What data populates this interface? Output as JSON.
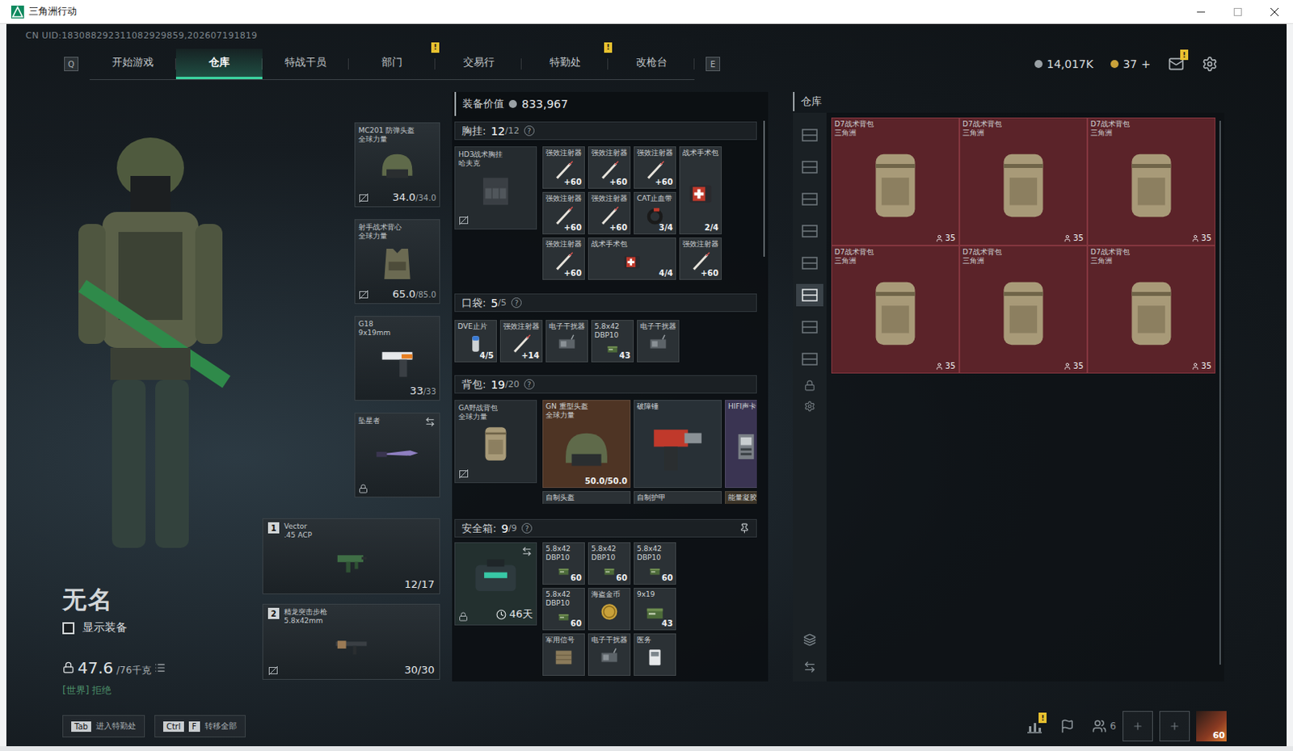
{
  "window": {
    "title": "三角洲行动"
  },
  "uid": "CN UID:183088292311082929859,202607191819",
  "nav": {
    "left_key": "Q",
    "right_key": "E",
    "tabs": [
      {
        "label": "开始游戏",
        "selected": false,
        "badge": ""
      },
      {
        "label": "仓库",
        "selected": true,
        "badge": ""
      },
      {
        "label": "特战干员",
        "selected": false,
        "badge": ""
      },
      {
        "label": "部门",
        "selected": false,
        "badge": "!"
      },
      {
        "label": "交易行",
        "selected": false,
        "badge": ""
      },
      {
        "label": "特勤处",
        "selected": false,
        "badge": "!"
      },
      {
        "label": "改枪台",
        "selected": false,
        "badge": ""
      }
    ]
  },
  "wallet": {
    "coins": "14,017K",
    "tokens": "37",
    "add": "+",
    "mail_badge": "!"
  },
  "character": {
    "name": "无名",
    "show_equipment": {
      "label": "显示装备",
      "checked": false
    },
    "weight": "47.6",
    "weight_max": "/76千克",
    "channel": "[世界] 拒绝"
  },
  "gear": [
    {
      "name": "MC201 防弹头盔",
      "sub": "全球力量",
      "reading": "34.0",
      "max": "/34.0",
      "kind": "helmet",
      "no_insure": true,
      "locked": false,
      "swap": false
    },
    {
      "name": "射手战术背心",
      "sub": "全球力量",
      "reading": "65.0",
      "max": "/85.0",
      "kind": "armor",
      "no_insure": true,
      "locked": false,
      "swap": false
    },
    {
      "name": "G18",
      "sub": "9x19mm",
      "reading": "33",
      "max": "/33",
      "kind": "pistol",
      "no_insure": false,
      "locked": false,
      "swap": false
    },
    {
      "name": "坠星者",
      "sub": "",
      "reading": "",
      "max": "",
      "kind": "knife",
      "no_insure": false,
      "locked": true,
      "swap": true
    }
  ],
  "weapons": [
    {
      "slot": "1",
      "name": "Vector",
      "sub": ".45 ACP",
      "reading": "12",
      "max": "/17",
      "kind": "smg",
      "no_insure": false
    },
    {
      "slot": "2",
      "name": "精龙突击步枪",
      "sub": "5.8x42mm",
      "reading": "30",
      "max": "/30",
      "kind": "rifle",
      "no_insure": true
    }
  ],
  "loadout": {
    "value_label": "装备价值",
    "value": "833,967",
    "rig": {
      "title": "胸挂:",
      "count": "12",
      "cap": "/12",
      "help": "?",
      "card": {
        "name": "HD3战术胸挂",
        "sub": "哈夫克",
        "no_insure": true
      },
      "items": [
        {
          "name": "强效注射器",
          "sub": "",
          "count": "+60",
          "kind": "syringe",
          "size": "small",
          "color": "#2b3135"
        },
        {
          "name": "强效注射器",
          "sub": "",
          "count": "+60",
          "kind": "syringe",
          "size": "small",
          "color": "#2b3135"
        },
        {
          "name": "强效注射器",
          "sub": "",
          "count": "+60",
          "kind": "syringe",
          "size": "small",
          "color": "#2b3135"
        },
        {
          "name": "战术手术包",
          "sub": "",
          "count": "2/4",
          "kind": "medkit",
          "size": "tall",
          "color": "#2b3135"
        },
        {
          "name": "强效注射器",
          "sub": "",
          "count": "+60",
          "kind": "syringe",
          "size": "small",
          "color": "#2b3135"
        },
        {
          "name": "强效注射器",
          "sub": "",
          "count": "+60",
          "kind": "syringe",
          "size": "small",
          "color": "#2b3135"
        },
        {
          "name": "CAT止血带",
          "sub": "",
          "count": "3/4",
          "kind": "tourniquet",
          "size": "small",
          "color": "#2b3135"
        },
        {
          "name": "强效注射器",
          "sub": "",
          "count": "+60",
          "kind": "syringe",
          "size": "small",
          "color": "#2b3135"
        },
        {
          "name": "战术手术包",
          "sub": "",
          "count": "4/4",
          "kind": "medkit",
          "size": "wide",
          "color": "#2b3135"
        },
        {
          "name": "强效注射器",
          "sub": "",
          "count": "+60",
          "kind": "syringe",
          "size": "small",
          "color": "#2b3135"
        }
      ]
    },
    "pockets": {
      "title": "口袋:",
      "count": "5",
      "cap": "/5",
      "help": "?",
      "items": [
        {
          "name": "DVE止片",
          "sub": "",
          "count": "4/5",
          "kind": "pill",
          "size": "small",
          "color": "#2b3135"
        },
        {
          "name": "强效注射器",
          "sub": "",
          "count": "+14",
          "kind": "syringe",
          "size": "small",
          "color": "#2b3135"
        },
        {
          "name": "电子干扰器",
          "sub": "",
          "count": "",
          "kind": "jammer",
          "size": "small",
          "color": "#2b3135"
        },
        {
          "name": "5.8x42 DBP10",
          "sub": "",
          "count": "43",
          "kind": "ammo",
          "size": "small",
          "color": "#2b3135"
        },
        {
          "name": "电子干扰器",
          "sub": "",
          "count": "",
          "kind": "jammer",
          "size": "small",
          "color": "#2b3135"
        }
      ]
    },
    "backpack": {
      "title": "背包:",
      "count": "19",
      "cap": "/20",
      "help": "?",
      "card": {
        "name": "GA野战背包",
        "sub": "全球力量",
        "no_insure": true
      },
      "items": [
        {
          "name": "GN 重型头盔",
          "sub": "全球力量",
          "count": "50.0/50.0",
          "kind": "helmet",
          "size": "large",
          "color": "#4e3424"
        },
        {
          "name": "破障锤",
          "sub": "",
          "count": "",
          "kind": "hammer",
          "size": "large",
          "color": "#283036"
        },
        {
          "name": "HIFI声卡",
          "sub": "",
          "count": "",
          "kind": "card",
          "size": "tall",
          "color": "#3a3452"
        },
        {
          "name": "自制头盔",
          "sub": "",
          "count": "",
          "kind": "helmet",
          "size": "large",
          "color": "#2b3135"
        },
        {
          "name": "自制护甲",
          "sub": "",
          "count": "",
          "kind": "armor",
          "size": "large",
          "color": "#2b3135"
        },
        {
          "name": "能量凝胶",
          "sub": "",
          "count": "",
          "kind": "gel",
          "size": "tall",
          "color": "#3b3428"
        }
      ]
    },
    "safe": {
      "title": "安全箱:",
      "count": "9",
      "cap": "/9",
      "help": "?",
      "pinned": true,
      "card": {
        "days": "46天",
        "locked": true,
        "swap": true
      },
      "items": [
        {
          "name": "5.8x42 DBP10",
          "sub": "",
          "count": "60",
          "kind": "ammo",
          "size": "small",
          "color": "#2b3135"
        },
        {
          "name": "5.8x42 DBP10",
          "sub": "",
          "count": "60",
          "kind": "ammo",
          "size": "small",
          "color": "#2b3135"
        },
        {
          "name": "5.8x42 DBP10",
          "sub": "",
          "count": "60",
          "kind": "ammo",
          "size": "small",
          "color": "#2b3135"
        },
        {
          "name": "5.8x42 DBP10",
          "sub": "",
          "count": "60",
          "kind": "ammo",
          "size": "small",
          "color": "#2b3135"
        },
        {
          "name": "海盗金币",
          "sub": "",
          "count": "",
          "kind": "coin",
          "size": "small",
          "color": "#2b3135"
        },
        {
          "name": "9x19",
          "sub": "",
          "count": "43",
          "kind": "ammo",
          "size": "small",
          "color": "#2b3135"
        },
        {
          "name": "军用信号",
          "sub": "",
          "count": "",
          "kind": "board",
          "size": "small",
          "color": "#2b3135"
        },
        {
          "name": "电子干扰器",
          "sub": "",
          "count": "",
          "kind": "jammer",
          "size": "small",
          "color": "#2b3135"
        },
        {
          "name": "医务",
          "sub": "",
          "count": "",
          "kind": "keycard",
          "size": "small",
          "color": "#2b3135"
        }
      ]
    }
  },
  "warehouse": {
    "title": "仓库",
    "tabs": [
      {
        "selected": false
      },
      {
        "selected": false
      },
      {
        "selected": false
      },
      {
        "selected": false
      },
      {
        "selected": false
      },
      {
        "selected": true
      },
      {
        "selected": false
      },
      {
        "selected": false
      }
    ],
    "items": [
      {
        "name": "D7战术背包",
        "sub": "三角洲",
        "count": "35",
        "color": "#5b2329"
      },
      {
        "name": "D7战术背包",
        "sub": "三角洲",
        "count": "35",
        "color": "#5b2329"
      },
      {
        "name": "D7战术背包",
        "sub": "三角洲",
        "count": "35",
        "color": "#5b2329"
      },
      {
        "name": "D7战术背包",
        "sub": "三角洲",
        "count": "35",
        "color": "#5b2329"
      },
      {
        "name": "D7战术背包",
        "sub": "三角洲",
        "count": "35",
        "color": "#5b2329"
      },
      {
        "name": "D7战术背包",
        "sub": "三角洲",
        "count": "35",
        "color": "#5b2329"
      }
    ]
  },
  "footer": {
    "keys": [
      {
        "caps": [
          "Tab"
        ],
        "label": "进入特勤处"
      },
      {
        "caps": [
          "Ctrl",
          "F"
        ],
        "label": "转移全部"
      }
    ],
    "stats_badge": "!",
    "friends": "6",
    "slots": [
      {
        "filled": false
      },
      {
        "filled": false
      }
    ],
    "level": "60"
  }
}
